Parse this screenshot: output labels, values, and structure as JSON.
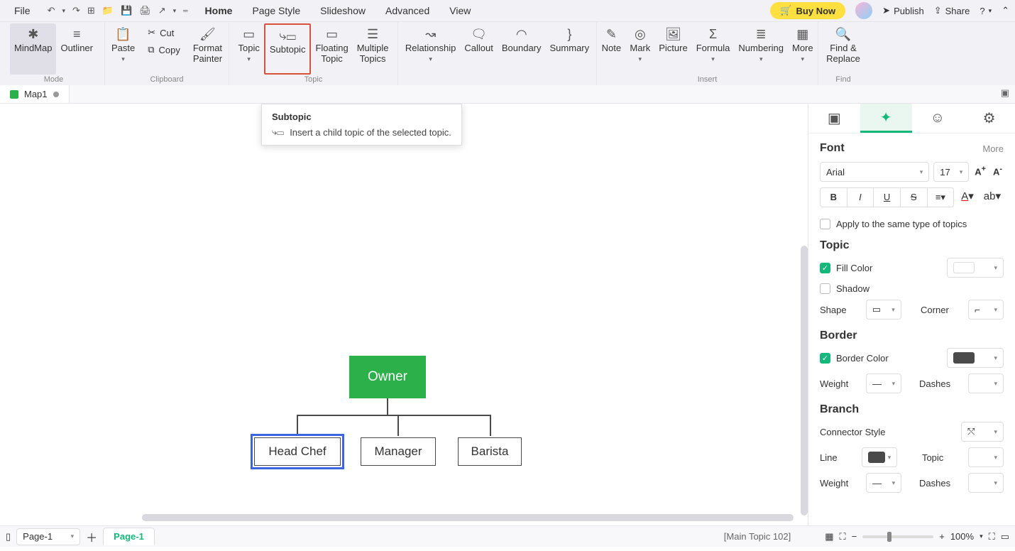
{
  "menubar": {
    "file": "File",
    "items": [
      "Home",
      "Page Style",
      "Slideshow",
      "Advanced",
      "View"
    ],
    "active": 0,
    "buy_now": "Buy Now",
    "publish": "Publish",
    "share": "Share"
  },
  "ribbon": {
    "mode": {
      "mindmap": "MindMap",
      "outliner": "Outliner",
      "label": "Mode"
    },
    "clipboard": {
      "paste": "Paste",
      "cut": "Cut",
      "copy": "Copy",
      "format_painter": "Format\nPainter",
      "label": "Clipboard"
    },
    "topic": {
      "topic": "Topic",
      "subtopic": "Subtopic",
      "floating": "Floating\nTopic",
      "multiple": "Multiple\nTopics",
      "label": "Topic"
    },
    "relations": {
      "relationship": "Relationship",
      "callout": "Callout",
      "boundary": "Boundary",
      "summary": "Summary"
    },
    "insert": {
      "note": "Note",
      "mark": "Mark",
      "picture": "Picture",
      "formula": "Formula",
      "numbering": "Numbering",
      "more": "More",
      "label": "Insert"
    },
    "find": {
      "find_replace": "Find &\nReplace",
      "label": "Find"
    }
  },
  "tooltip": {
    "title": "Subtopic",
    "body": "Insert a child topic of the selected topic."
  },
  "doc_tab": {
    "name": "Map1"
  },
  "canvas": {
    "root": "Owner",
    "children": [
      "Head Chef",
      "Manager",
      "Barista"
    ],
    "selected_idx": 0
  },
  "panel": {
    "font": {
      "title": "Font",
      "more": "More",
      "family": "Arial",
      "size": "17",
      "apply": "Apply to the same type of topics"
    },
    "topic": {
      "title": "Topic",
      "fill": "Fill Color",
      "shadow": "Shadow",
      "shape": "Shape",
      "corner": "Corner"
    },
    "border": {
      "title": "Border",
      "color": "Border Color",
      "weight": "Weight",
      "dashes": "Dashes",
      "border_swatch": "#4a4a4a"
    },
    "branch": {
      "title": "Branch",
      "connector": "Connector Style",
      "line": "Line",
      "topic": "Topic",
      "weight": "Weight",
      "dashes": "Dashes",
      "line_swatch": "#4a4a4a"
    }
  },
  "status": {
    "page_dd": "Page-1",
    "page_tab": "Page-1",
    "hint": "[Main Topic 102]",
    "zoom": "100%"
  }
}
